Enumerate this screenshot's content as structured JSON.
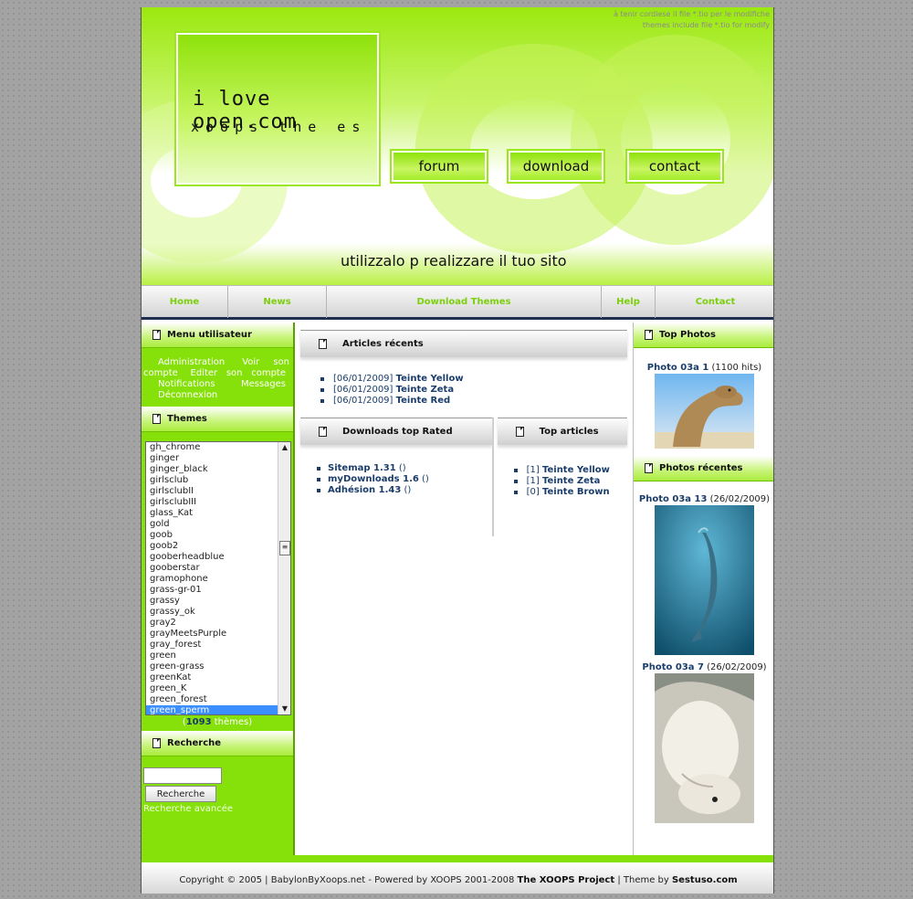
{
  "header": {
    "note_line1": "à tenir cordiese il file *.tio per le modifiche",
    "note_line2": "themes include file *.tio for modify",
    "logo_line1": "i love open.com",
    "logo_line2": "xoops the  es",
    "buttons": [
      "forum",
      "download",
      "contact"
    ],
    "tagline": "utilizzalo p  realizzare il tuo sito"
  },
  "nav": [
    "Home",
    "News",
    "Download Themes",
    "Help",
    "Contact"
  ],
  "left": {
    "user_menu_title": "Menu utilisateur",
    "user_menu_items": [
      "Administration",
      "Voir son compte",
      "Editer son compte",
      "Notifications",
      "Messages",
      "Déconnexion"
    ],
    "themes_title": "Themes",
    "themes": [
      "gh_chrome",
      "ginger",
      "ginger_black",
      "girlsclub",
      "girlsclubII",
      "girlsclubIII",
      "glass_Kat",
      "gold",
      "goob",
      "goob2",
      "gooberheadblue",
      "gooberstar",
      "gramophone",
      "grass-gr-01",
      "grassy",
      "grassy_ok",
      "gray2",
      "grayMeetsPurple",
      "gray_forest",
      "green",
      "green-grass",
      "greenKat",
      "green_K",
      "green_forest",
      "green_sperm"
    ],
    "themes_selected": "green_sperm",
    "themes_count": "1093",
    "themes_count_suffix": " thèmes)",
    "themes_count_prefix": "(",
    "search_title": "Recherche",
    "search_value": "",
    "search_button": "Recherche",
    "advanced_search": "Recherche avancée"
  },
  "center": {
    "recent_title": "Articles récents",
    "recent": [
      {
        "date": "[06/01/2009]",
        "title": "Teinte Yellow"
      },
      {
        "date": "[06/01/2009]",
        "title": "Teinte Zeta"
      },
      {
        "date": "[06/01/2009]",
        "title": "Teinte Red"
      }
    ],
    "downloads_title": "Downloads top Rated",
    "downloads": [
      {
        "name": "Sitemap 1.31",
        "extra": " ()"
      },
      {
        "name": "myDownloads 1.6",
        "extra": " ()"
      },
      {
        "name": "Adhésion 1.43",
        "extra": " ()"
      }
    ],
    "top_articles_title": "Top articles",
    "top_articles": [
      {
        "rank": "[1]",
        "title": "Teinte Yellow"
      },
      {
        "rank": "[1]",
        "title": "Teinte Zeta"
      },
      {
        "rank": "[0]",
        "title": "Teinte Brown"
      }
    ]
  },
  "right": {
    "top_photos_title": "Top Photos",
    "top_photo_name": "Photo 03a 1",
    "top_photo_hits": " (1100 hits)",
    "recent_photos_title": "Photos récentes",
    "recent_photo1_name": "Photo 03a 13",
    "recent_photo1_date": " (26/02/2009)",
    "recent_photo2_name": "Photo 03a 7",
    "recent_photo2_date": " (26/02/2009)"
  },
  "footer": {
    "text": "Copyright © 2005 | BabylonByXoops.net - Powered by XOOPS 2001-2008 ",
    "xoops": "The XOOPS Project",
    "mid": " | Theme by ",
    "author": "Sestuso.com"
  },
  "colors": {
    "accent_green": "#86e00a",
    "link_blue": "#1a3d6b",
    "nav_text": "#7ccf0c",
    "selection": "#3b8fff"
  }
}
